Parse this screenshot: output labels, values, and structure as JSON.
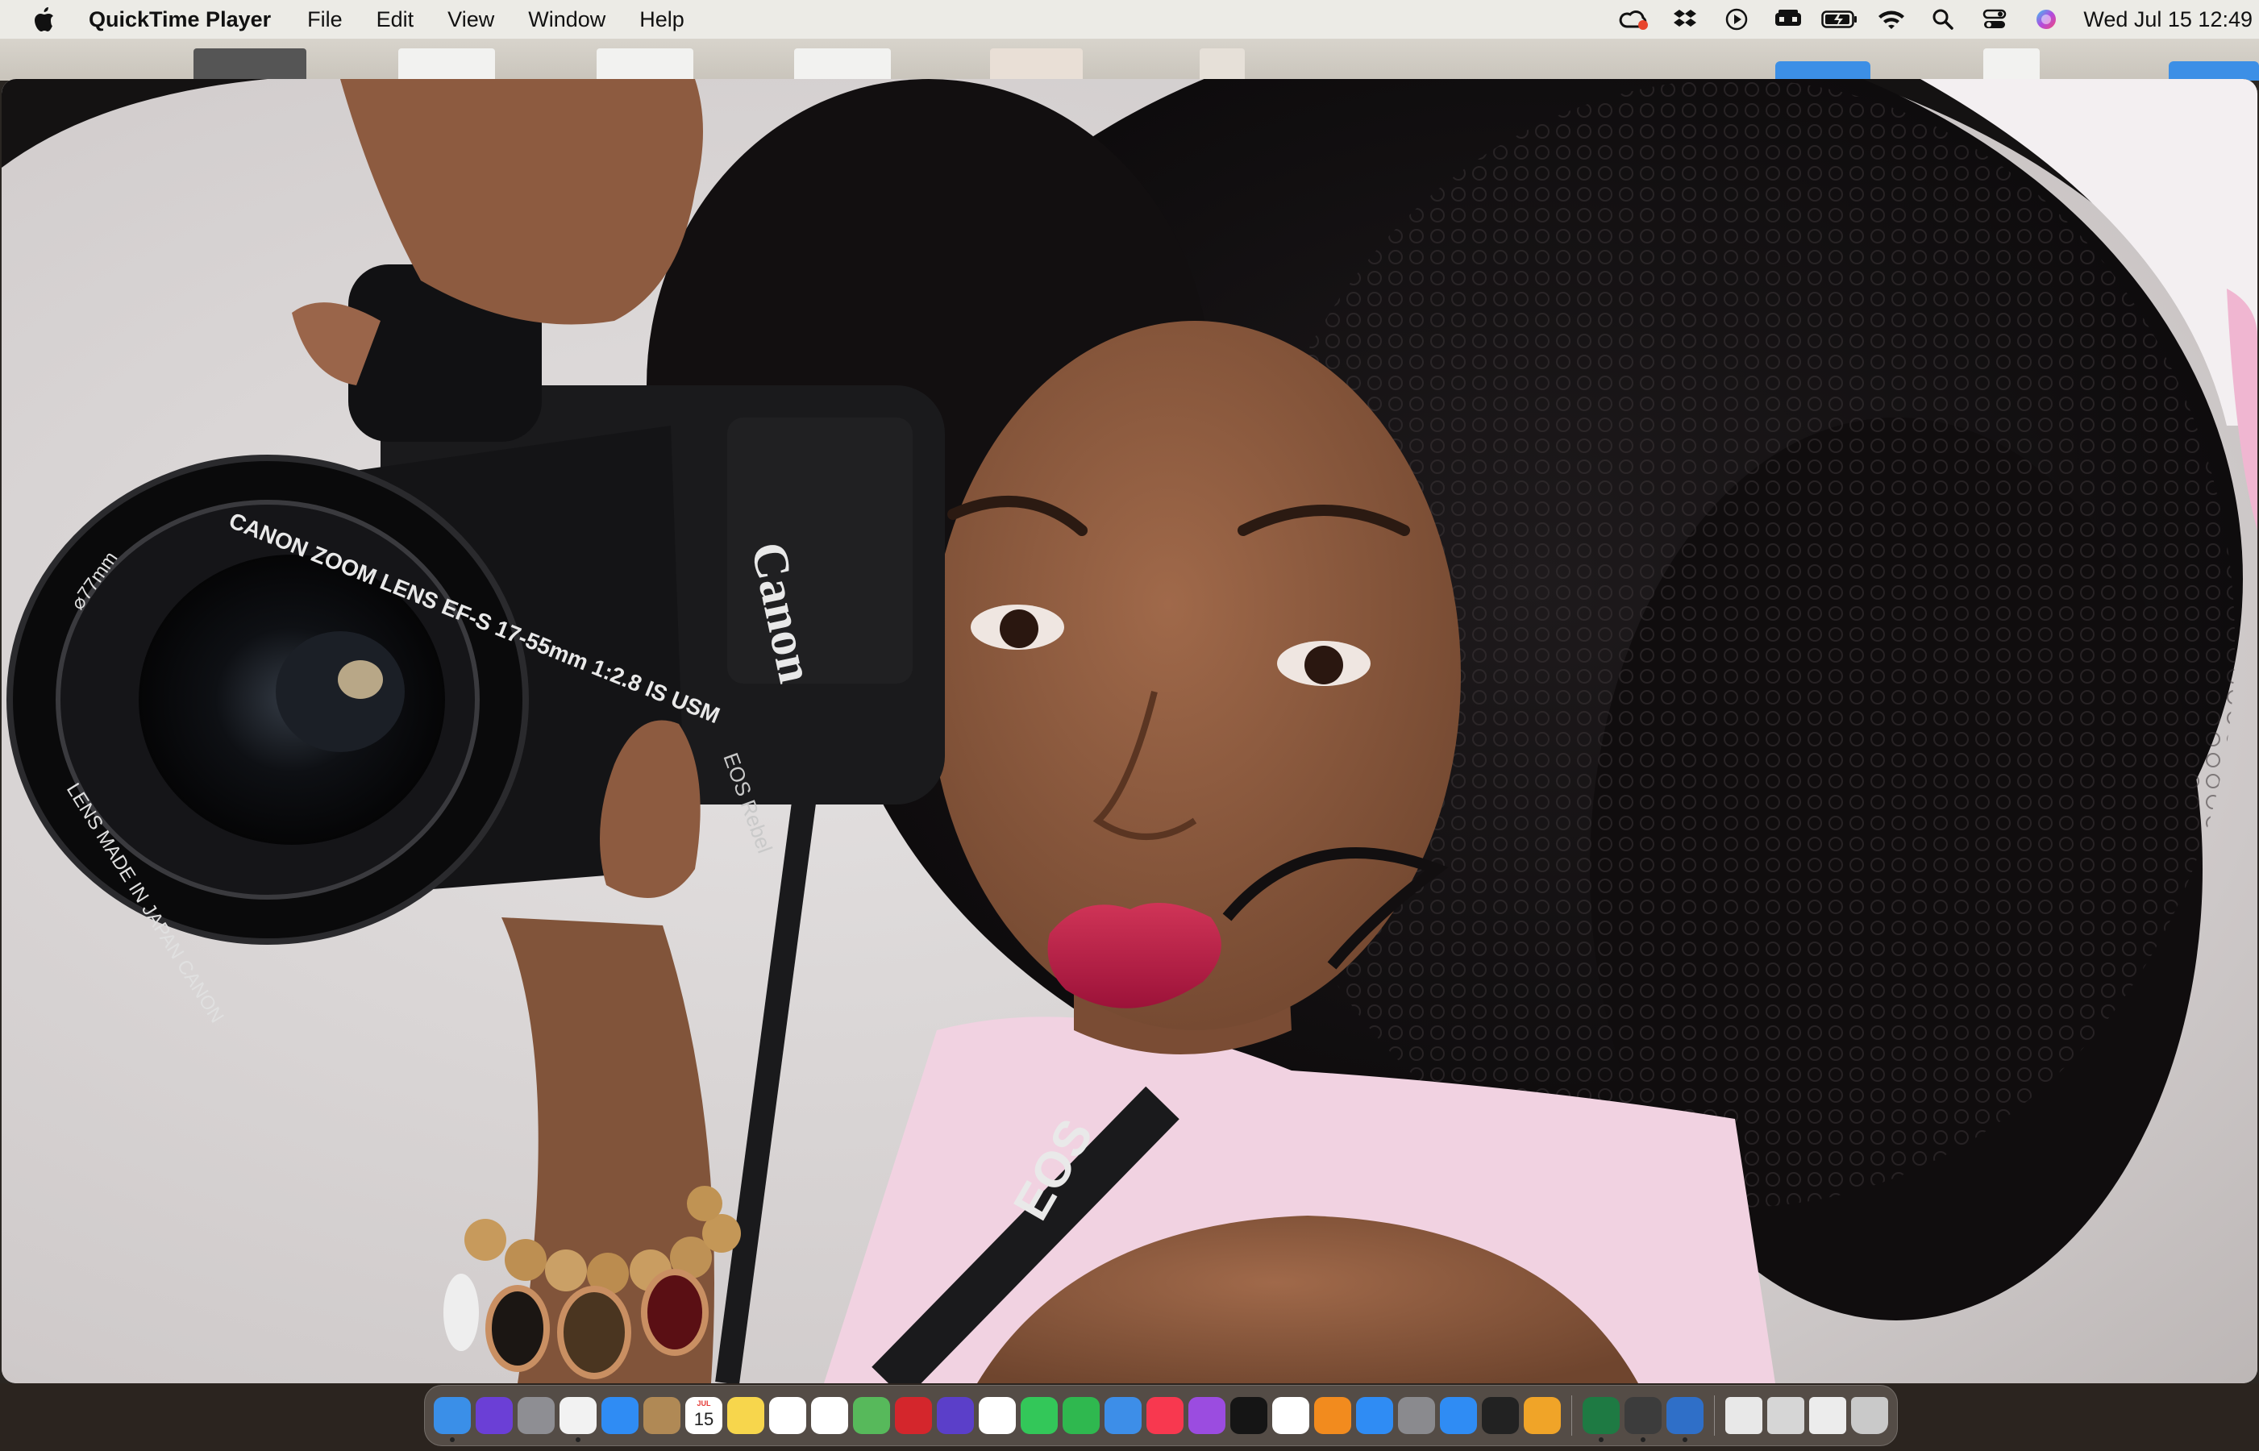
{
  "menubar": {
    "app_name": "QuickTime Player",
    "menus": [
      "File",
      "Edit",
      "View",
      "Window",
      "Help"
    ],
    "status_icons": [
      "creative-cloud-icon",
      "dropbox-icon",
      "media-play-icon",
      "menu-bar-app-icon",
      "battery-icon",
      "wifi-icon",
      "spotlight-search-icon",
      "control-center-icon",
      "siri-icon"
    ],
    "clock": "Wed Jul 15  12:49"
  },
  "video": {
    "camera_body_brand": "Canon",
    "camera_model": "EOS Rebel",
    "lens_ring_text": "CANON ZOOM LENS EF-S 17-55mm 1:2.8 IS USM",
    "lens_ring_lower": "LENS MADE IN JAPAN  CANON",
    "lens_diameter": "⌀77mm",
    "strap_text": "EOS"
  },
  "dock": {
    "apps": [
      {
        "name": "finder-icon",
        "color": "#3a8fe8",
        "running": true
      },
      {
        "name": "siri-icon",
        "color": "#6b3fd6",
        "running": false
      },
      {
        "name": "launchpad-icon",
        "color": "#8e8e93",
        "running": false
      },
      {
        "name": "chrome-icon",
        "color": "#f2f2f2",
        "running": true
      },
      {
        "name": "mail-icon",
        "color": "#2f8cf4",
        "running": false
      },
      {
        "name": "contacts-icon",
        "color": "#b08955",
        "running": false
      },
      {
        "name": "calendar-icon",
        "color": "#ffffff",
        "running": false
      },
      {
        "name": "notes-icon",
        "color": "#f7d64c",
        "running": false
      },
      {
        "name": "freeform-icon",
        "color": "#ffffff",
        "running": false
      },
      {
        "name": "reminders-icon",
        "color": "#ffffff",
        "running": false
      },
      {
        "name": "maps-icon",
        "color": "#57b95b",
        "running": false
      },
      {
        "name": "photo-booth-icon",
        "color": "#d4262c",
        "running": false
      },
      {
        "name": "imovie-icon",
        "color": "#5b3fc9",
        "running": false
      },
      {
        "name": "photos-icon",
        "color": "#ffffff",
        "running": false
      },
      {
        "name": "messages-icon",
        "color": "#33c759",
        "running": false
      },
      {
        "name": "facetime-icon",
        "color": "#2fb84f",
        "running": false
      },
      {
        "name": "weather-icon",
        "color": "#3d8ee8",
        "running": false
      },
      {
        "name": "music-icon",
        "color": "#f8384f",
        "running": false
      },
      {
        "name": "podcasts-icon",
        "color": "#9b4ce0",
        "running": false
      },
      {
        "name": "apple-tv-icon",
        "color": "#151515",
        "running": false
      },
      {
        "name": "news-icon",
        "color": "#ffffff",
        "running": false
      },
      {
        "name": "books-icon",
        "color": "#f28b1e",
        "running": false
      },
      {
        "name": "app-store-icon",
        "color": "#2f8cf4",
        "running": false
      },
      {
        "name": "system-settings-icon",
        "color": "#8a8a8e",
        "running": false
      },
      {
        "name": "safari-icon",
        "color": "#2f8cf4",
        "running": false
      },
      {
        "name": "garageband-icon",
        "color": "#222222",
        "running": false
      },
      {
        "name": "fl-studio-icon",
        "color": "#f0a428",
        "running": false
      },
      {
        "name": "excel-icon",
        "color": "#1e7a43",
        "running": true
      },
      {
        "name": "davinci-resolve-icon",
        "color": "#3c3c3c",
        "running": true
      },
      {
        "name": "quicktime-player-icon",
        "color": "#2f6fc8",
        "running": true
      }
    ],
    "stack_items": [
      {
        "name": "documents-stack-icon",
        "color": "#e8e8e8"
      },
      {
        "name": "downloads-stack-icon",
        "color": "#d6d6d6"
      },
      {
        "name": "screenshots-stack-icon",
        "color": "#ececec"
      },
      {
        "name": "trash-icon",
        "color": "#c9c9c9"
      }
    ],
    "calendar": {
      "month": "JUL",
      "day": "15"
    }
  },
  "colors": {
    "menubar_bg": "#ecebe6",
    "backdrop": "#d9d6d5",
    "hair": "#141112",
    "skin": "#8a5a3f",
    "lips": "#c4254c",
    "sweater": "#f3d3e2",
    "camera": "#1a1a1c"
  }
}
